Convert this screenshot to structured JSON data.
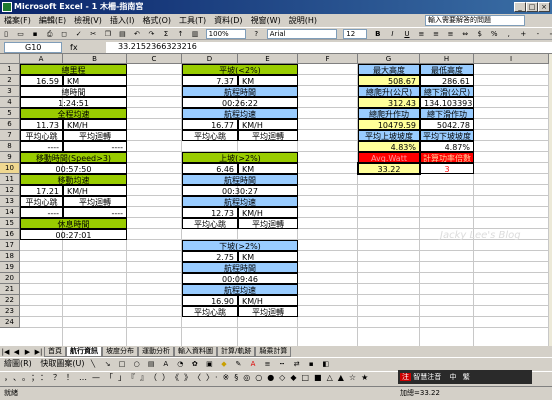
{
  "window": {
    "title": "Microsoft Excel - 1 木柵-指南宮"
  },
  "menu": [
    "檔案(F)",
    "編輯(E)",
    "檢視(V)",
    "插入(I)",
    "格式(O)",
    "工具(T)",
    "資料(D)",
    "視窗(W)",
    "說明(H)"
  ],
  "help_box": {
    "placeholder": "輸入需要解答的問題"
  },
  "toolbar": {
    "zoom": "100%",
    "font": "Arial",
    "font_size": "12"
  },
  "formula_bar": {
    "name_box": "G10",
    "fx": "fx",
    "formula": "33.2152366323216"
  },
  "columns": [
    "A",
    "B",
    "C",
    "D",
    "E",
    "F",
    "G",
    "H",
    "I"
  ],
  "rows": [
    "1",
    "2",
    "3",
    "4",
    "5",
    "6",
    "7",
    "8",
    "9",
    "10",
    "11",
    "12",
    "13",
    "14",
    "15",
    "16",
    "17",
    "18",
    "19",
    "20",
    "21",
    "22",
    "23",
    "24"
  ],
  "cells": {
    "a1": "總里程",
    "a2v": "16.59",
    "a2u": "KM",
    "a3": "總時間",
    "a4": "1:24:51",
    "a5": "全程均速",
    "a6v": "11.73",
    "a6u": "KM/H",
    "a7a": "平均心跳",
    "a7b": "平均迴轉",
    "a8a": "----",
    "a8b": "----",
    "a9": "移動時間(Speed>3)",
    "a10": "00:57:50",
    "a11": "移動均速",
    "a12v": "17.21",
    "a12u": "KM/H",
    "a13a": "平均心跳",
    "a13b": "平均迴轉",
    "a14a": "----",
    "a14b": "----",
    "a15": "休息時間",
    "a16": "00:27:01",
    "d1": "平坡(<2%)",
    "d2v": "7.37",
    "d2u": "KM",
    "d3": "航程時間",
    "d4": "00:26:22",
    "d5": "航程均速",
    "d6v": "16.77",
    "d6u": "KM/H",
    "d7a": "平均心跳",
    "d7b": "平均迴轉",
    "d9": "上坡(>2%)",
    "d10v": "6.46",
    "d10u": "KM",
    "d11": "航程時間",
    "d12": "00:30:27",
    "d13": "航程均速",
    "d14v": "12.73",
    "d14u": "KM/H",
    "d15a": "平均心跳",
    "d15b": "平均迴轉",
    "d17": "下坡(>2%)",
    "d18v": "2.75",
    "d18u": "KM",
    "d19": "航程時間",
    "d20": "00:09:46",
    "d21": "航程均速",
    "d22v": "16.90",
    "d22u": "KM/H",
    "d23a": "平均心跳",
    "d23b": "平均迴轉",
    "g1": "最大高度",
    "h1": "最低高度",
    "g2": "508.67",
    "h2": "286.61",
    "g3": "總爬升(公尺)",
    "h3": "總下滑(公尺)",
    "g4": "312.43",
    "h4": "134.1033935",
    "g5": "總爬升作功",
    "h5": "總下滑作功",
    "g6": "10479.59",
    "h6": "5042.78",
    "g7": "平均上坡坡度",
    "h7": "平均下坡坡度",
    "g8": "4.83%",
    "h8": "4.87%",
    "g9": "Avg.Watt",
    "h9": "計算功率倍數",
    "g10": "33.22",
    "h10": "3"
  },
  "watermark": "Jacky Lee's Blog",
  "sheets": [
    "首頁",
    "航行資訊",
    "坡度分布",
    "運動分析",
    "輸入資料圖",
    "計算/軌跡",
    "騎乘計算"
  ],
  "active_sheet": "航行資訊",
  "drawbar": {
    "draw": "繪圖(R)",
    "shapes": "快取圖案(U)"
  },
  "ime": {
    "brand": "注",
    "label": "智慧注音",
    "mode": "中",
    "punct": "繁"
  },
  "status": {
    "left": "就緒",
    "sum": "加總=33.22"
  },
  "colors": {
    "green": "#99cc00",
    "blue": "#99ccff",
    "yellow": "#ffff99",
    "red": "#ff0000",
    "title": "#0a246a"
  }
}
